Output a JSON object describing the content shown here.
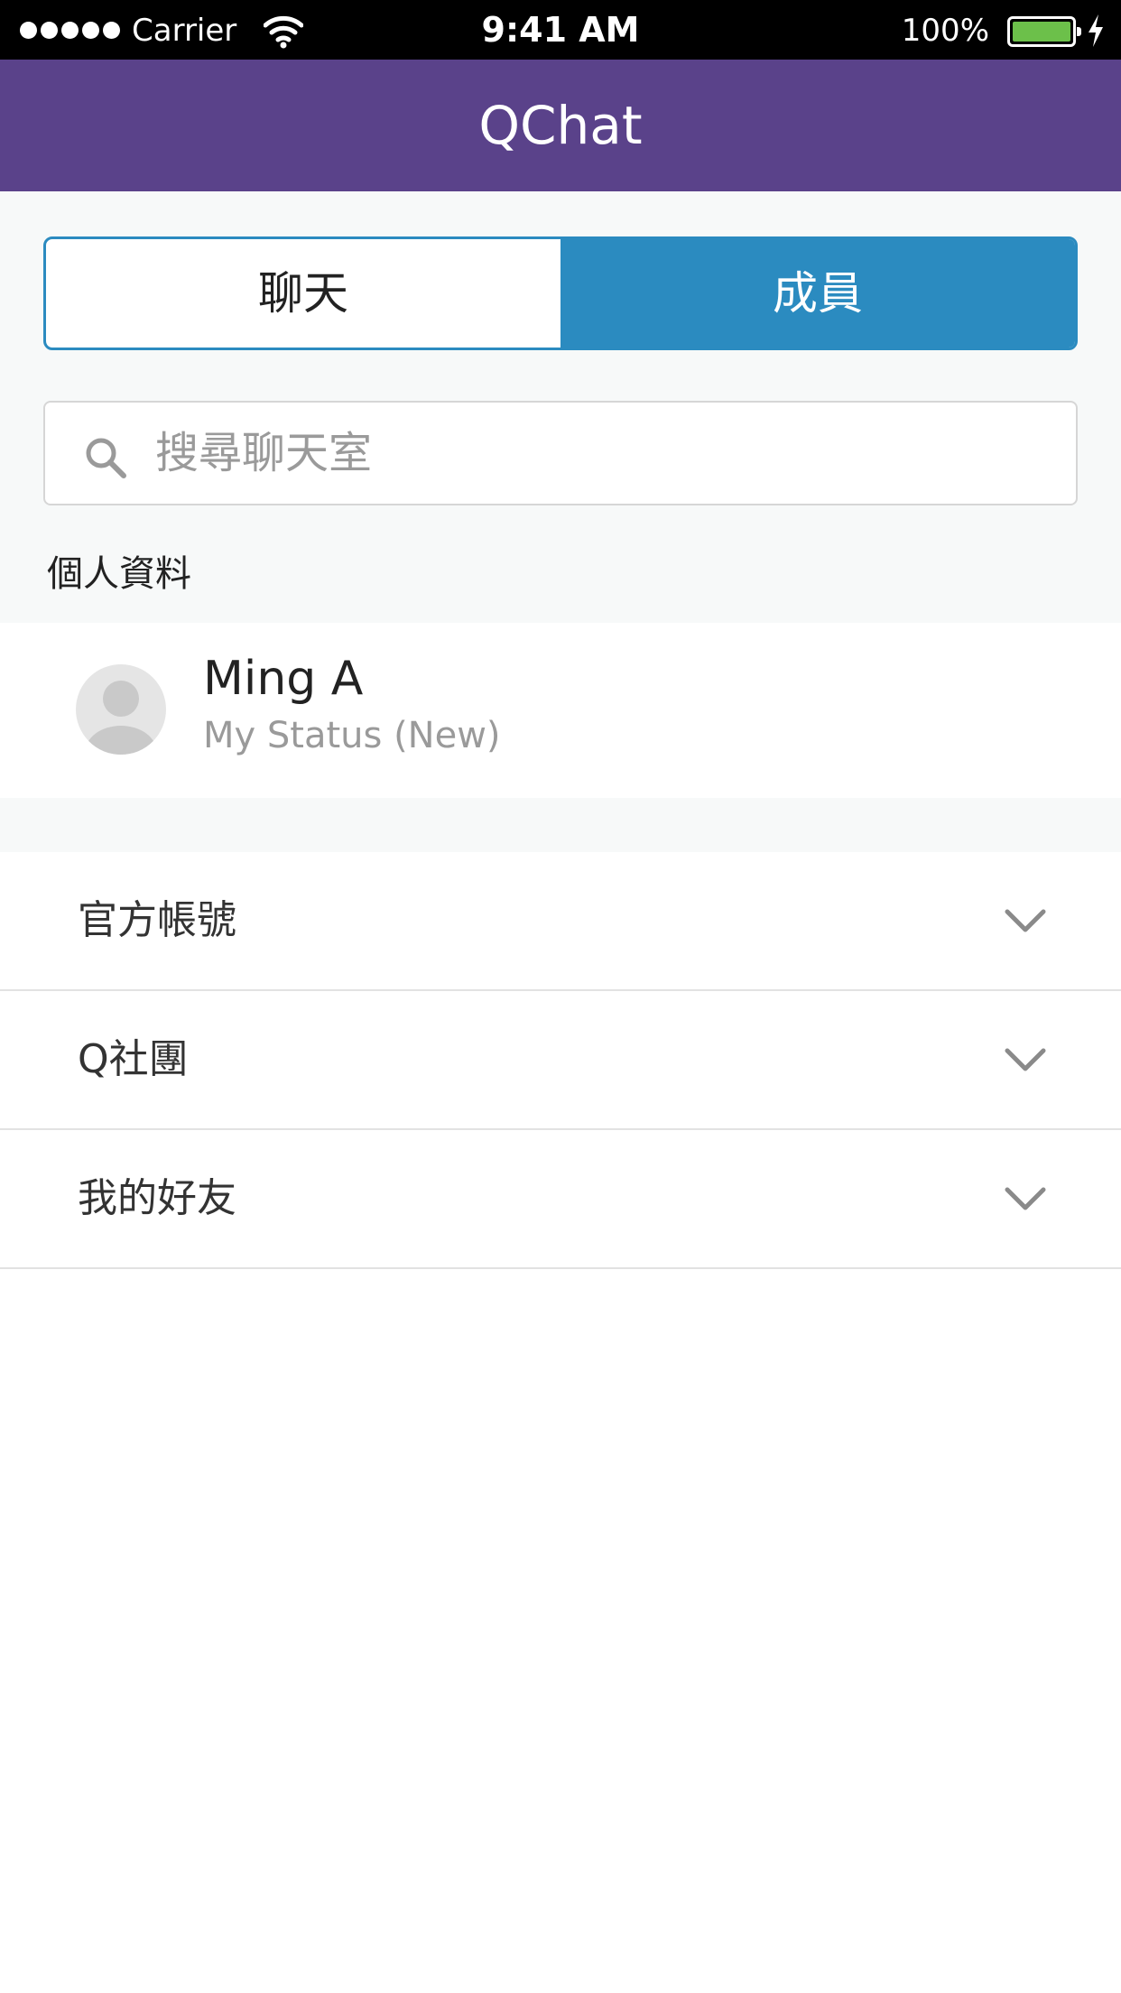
{
  "status_bar": {
    "carrier": "Carrier",
    "time": "9:41 AM",
    "battery": "100%",
    "signal_bars": 5,
    "battery_color": "#6cc04a"
  },
  "nav": {
    "title": "QChat",
    "color": "#5a428a"
  },
  "tabs": {
    "items": [
      {
        "label": "聊天",
        "selected": false
      },
      {
        "label": "成員",
        "selected": true
      }
    ],
    "accent": "#2b8bc0"
  },
  "search": {
    "placeholder": "搜尋聊天室",
    "value": ""
  },
  "profile_section": {
    "label": "個人資料",
    "name": "Ming A",
    "status": "My Status (New)"
  },
  "groups": [
    {
      "label": "官方帳號",
      "icon": "chevron-down-icon"
    },
    {
      "label": "Q社團",
      "icon": "chevron-down-icon"
    },
    {
      "label": "我的好友",
      "icon": "chevron-down-icon"
    }
  ]
}
